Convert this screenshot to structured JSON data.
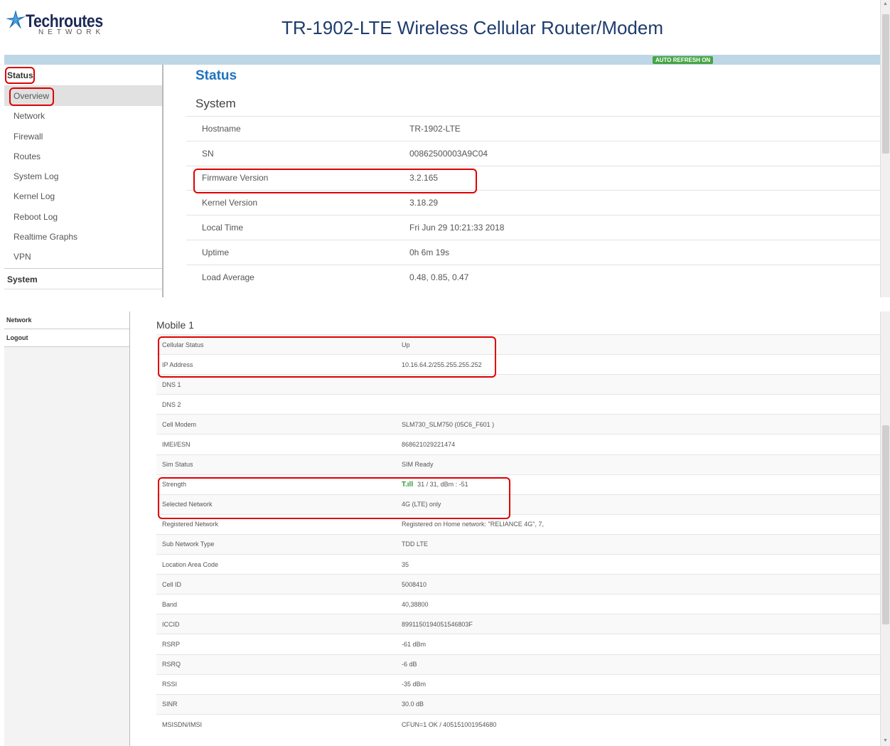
{
  "header": {
    "logo_text": "Techroutes",
    "logo_sub": "NETWORK",
    "title": "TR-1902-LTE Wireless Cellular Router/Modem",
    "auto_refresh": "AUTO REFRESH ON"
  },
  "sidebar": {
    "status_label": "Status",
    "items": [
      {
        "label": "Overview"
      },
      {
        "label": "Network"
      },
      {
        "label": "Firewall"
      },
      {
        "label": "Routes"
      },
      {
        "label": "System Log"
      },
      {
        "label": "Kernel Log"
      },
      {
        "label": "Reboot Log"
      },
      {
        "label": "Realtime Graphs"
      },
      {
        "label": "VPN"
      }
    ],
    "system_label": "System"
  },
  "sidebar_bottom": {
    "items": [
      {
        "label": "Network"
      },
      {
        "label": "Logout"
      }
    ]
  },
  "status": {
    "heading": "Status",
    "system_heading": "System",
    "rows": [
      {
        "key": "Hostname",
        "value": "TR-1902-LTE"
      },
      {
        "key": "SN",
        "value": "00862500003A9C04"
      },
      {
        "key": "Firmware Version",
        "value": "3.2.165"
      },
      {
        "key": "Kernel Version",
        "value": "3.18.29"
      },
      {
        "key": "Local Time",
        "value": "Fri Jun 29 10:21:33 2018"
      },
      {
        "key": "Uptime",
        "value": "0h 6m 19s"
      },
      {
        "key": "Load Average",
        "value": "0.48, 0.85, 0.47"
      }
    ]
  },
  "mobile": {
    "heading": "Mobile 1",
    "rows": [
      {
        "key": "Cellular Status",
        "value": "Up"
      },
      {
        "key": "IP Address",
        "value": "10.16.64.2/255.255.255.252"
      },
      {
        "key": "DNS 1",
        "value": ""
      },
      {
        "key": "DNS 2",
        "value": ""
      },
      {
        "key": "Cell Modem",
        "value": "SLM730_SLM750 (05C6_F601 )"
      },
      {
        "key": "IMEI/ESN",
        "value": "868621029221474"
      },
      {
        "key": "Sim Status",
        "value": "SIM Ready"
      },
      {
        "key": "Strength",
        "value": "31 / 31, dBm : -51"
      },
      {
        "key": "Selected Network",
        "value": "4G (LTE) only"
      },
      {
        "key": "Registered Network",
        "value": "Registered on Home network: \"RELIANCE 4G\", 7,"
      },
      {
        "key": "Sub Network Type",
        "value": "TDD LTE"
      },
      {
        "key": "Location Area Code",
        "value": "35"
      },
      {
        "key": "Cell ID",
        "value": "5008410"
      },
      {
        "key": "Band",
        "value": "40,38800"
      },
      {
        "key": "ICCID",
        "value": "8991150194051546803F"
      },
      {
        "key": "RSRP",
        "value": "-61 dBm"
      },
      {
        "key": "RSRQ",
        "value": "-6 dB"
      },
      {
        "key": "RSSI",
        "value": "-35 dBm"
      },
      {
        "key": "SINR",
        "value": "30.0 dB"
      },
      {
        "key": "MSISDN/IMSI",
        "value": "CFUN=1 OK / 405151001954680"
      }
    ],
    "signal_icon": "signal-bars-icon"
  },
  "colors": {
    "heading_blue": "#1e73be",
    "highlight_red": "#e00000",
    "header_bar": "#bdd7e6",
    "refresh_badge": "#46a546",
    "signal_green": "#2e9a2e"
  }
}
